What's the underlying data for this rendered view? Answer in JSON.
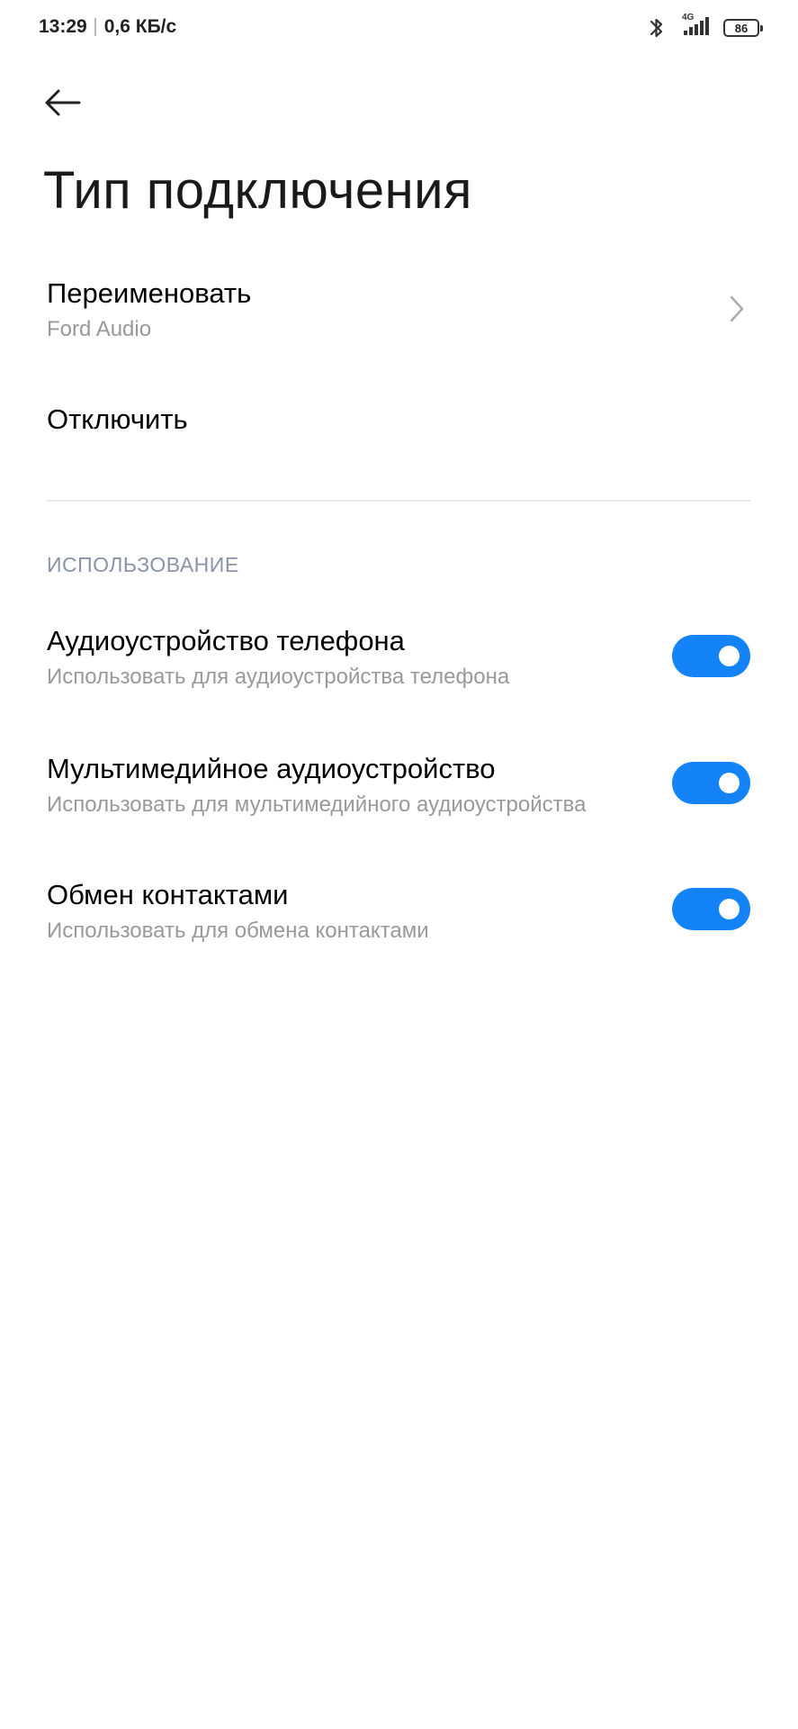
{
  "status_bar": {
    "time": "13:29",
    "speed": "0,6 КБ/с",
    "network": "4G",
    "battery": "86",
    "icons": [
      "bluetooth-icon",
      "signal-icon",
      "battery-icon"
    ]
  },
  "header": {
    "back_icon": "arrow-left-icon",
    "title": "Тип подключения"
  },
  "rename": {
    "title": "Переименовать",
    "value": "Ford Audio",
    "icon": "chevron-right-icon"
  },
  "disconnect": {
    "title": "Отключить"
  },
  "usage": {
    "section_title": "ИСПОЛЬЗОВАНИЕ",
    "items": [
      {
        "title": "Аудиоустройство телефона",
        "subtitle": "Использовать для аудиоустройства телефона",
        "enabled": true
      },
      {
        "title": "Мультимедийное аудиоустройство",
        "subtitle": "Использовать для мультимедийного аудиоустройства",
        "enabled": true
      },
      {
        "title": "Обмен контактами",
        "subtitle": "Использовать для обмена контактами",
        "enabled": true
      }
    ]
  },
  "colors": {
    "accent": "#1483f7",
    "section_header": "#8a93a8",
    "subtitle": "#999999"
  }
}
